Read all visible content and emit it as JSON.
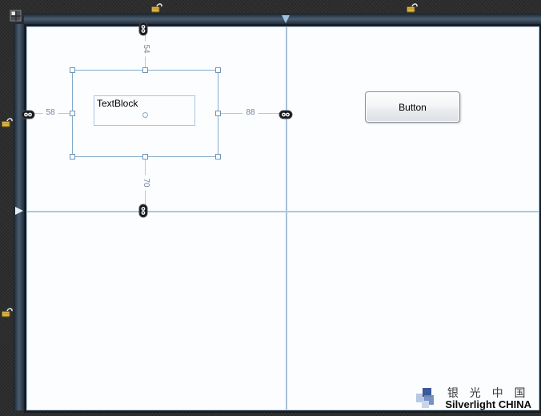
{
  "artboard": {
    "textblock_label": "TextBlock",
    "button_label": "Button",
    "margin_top": "54",
    "margin_left": "58",
    "margin_right": "88",
    "margin_bottom": "70"
  },
  "watermark": {
    "title_zh": "银 光 中 国",
    "subtitle_en": "Silverlight CHINA"
  },
  "colors": {
    "gridline": "#a6c0da",
    "selection_border": "#83aacb",
    "lock_gold": "#d9b544",
    "canvas_border": "#b3d2e8",
    "ruler": "#485c71"
  }
}
